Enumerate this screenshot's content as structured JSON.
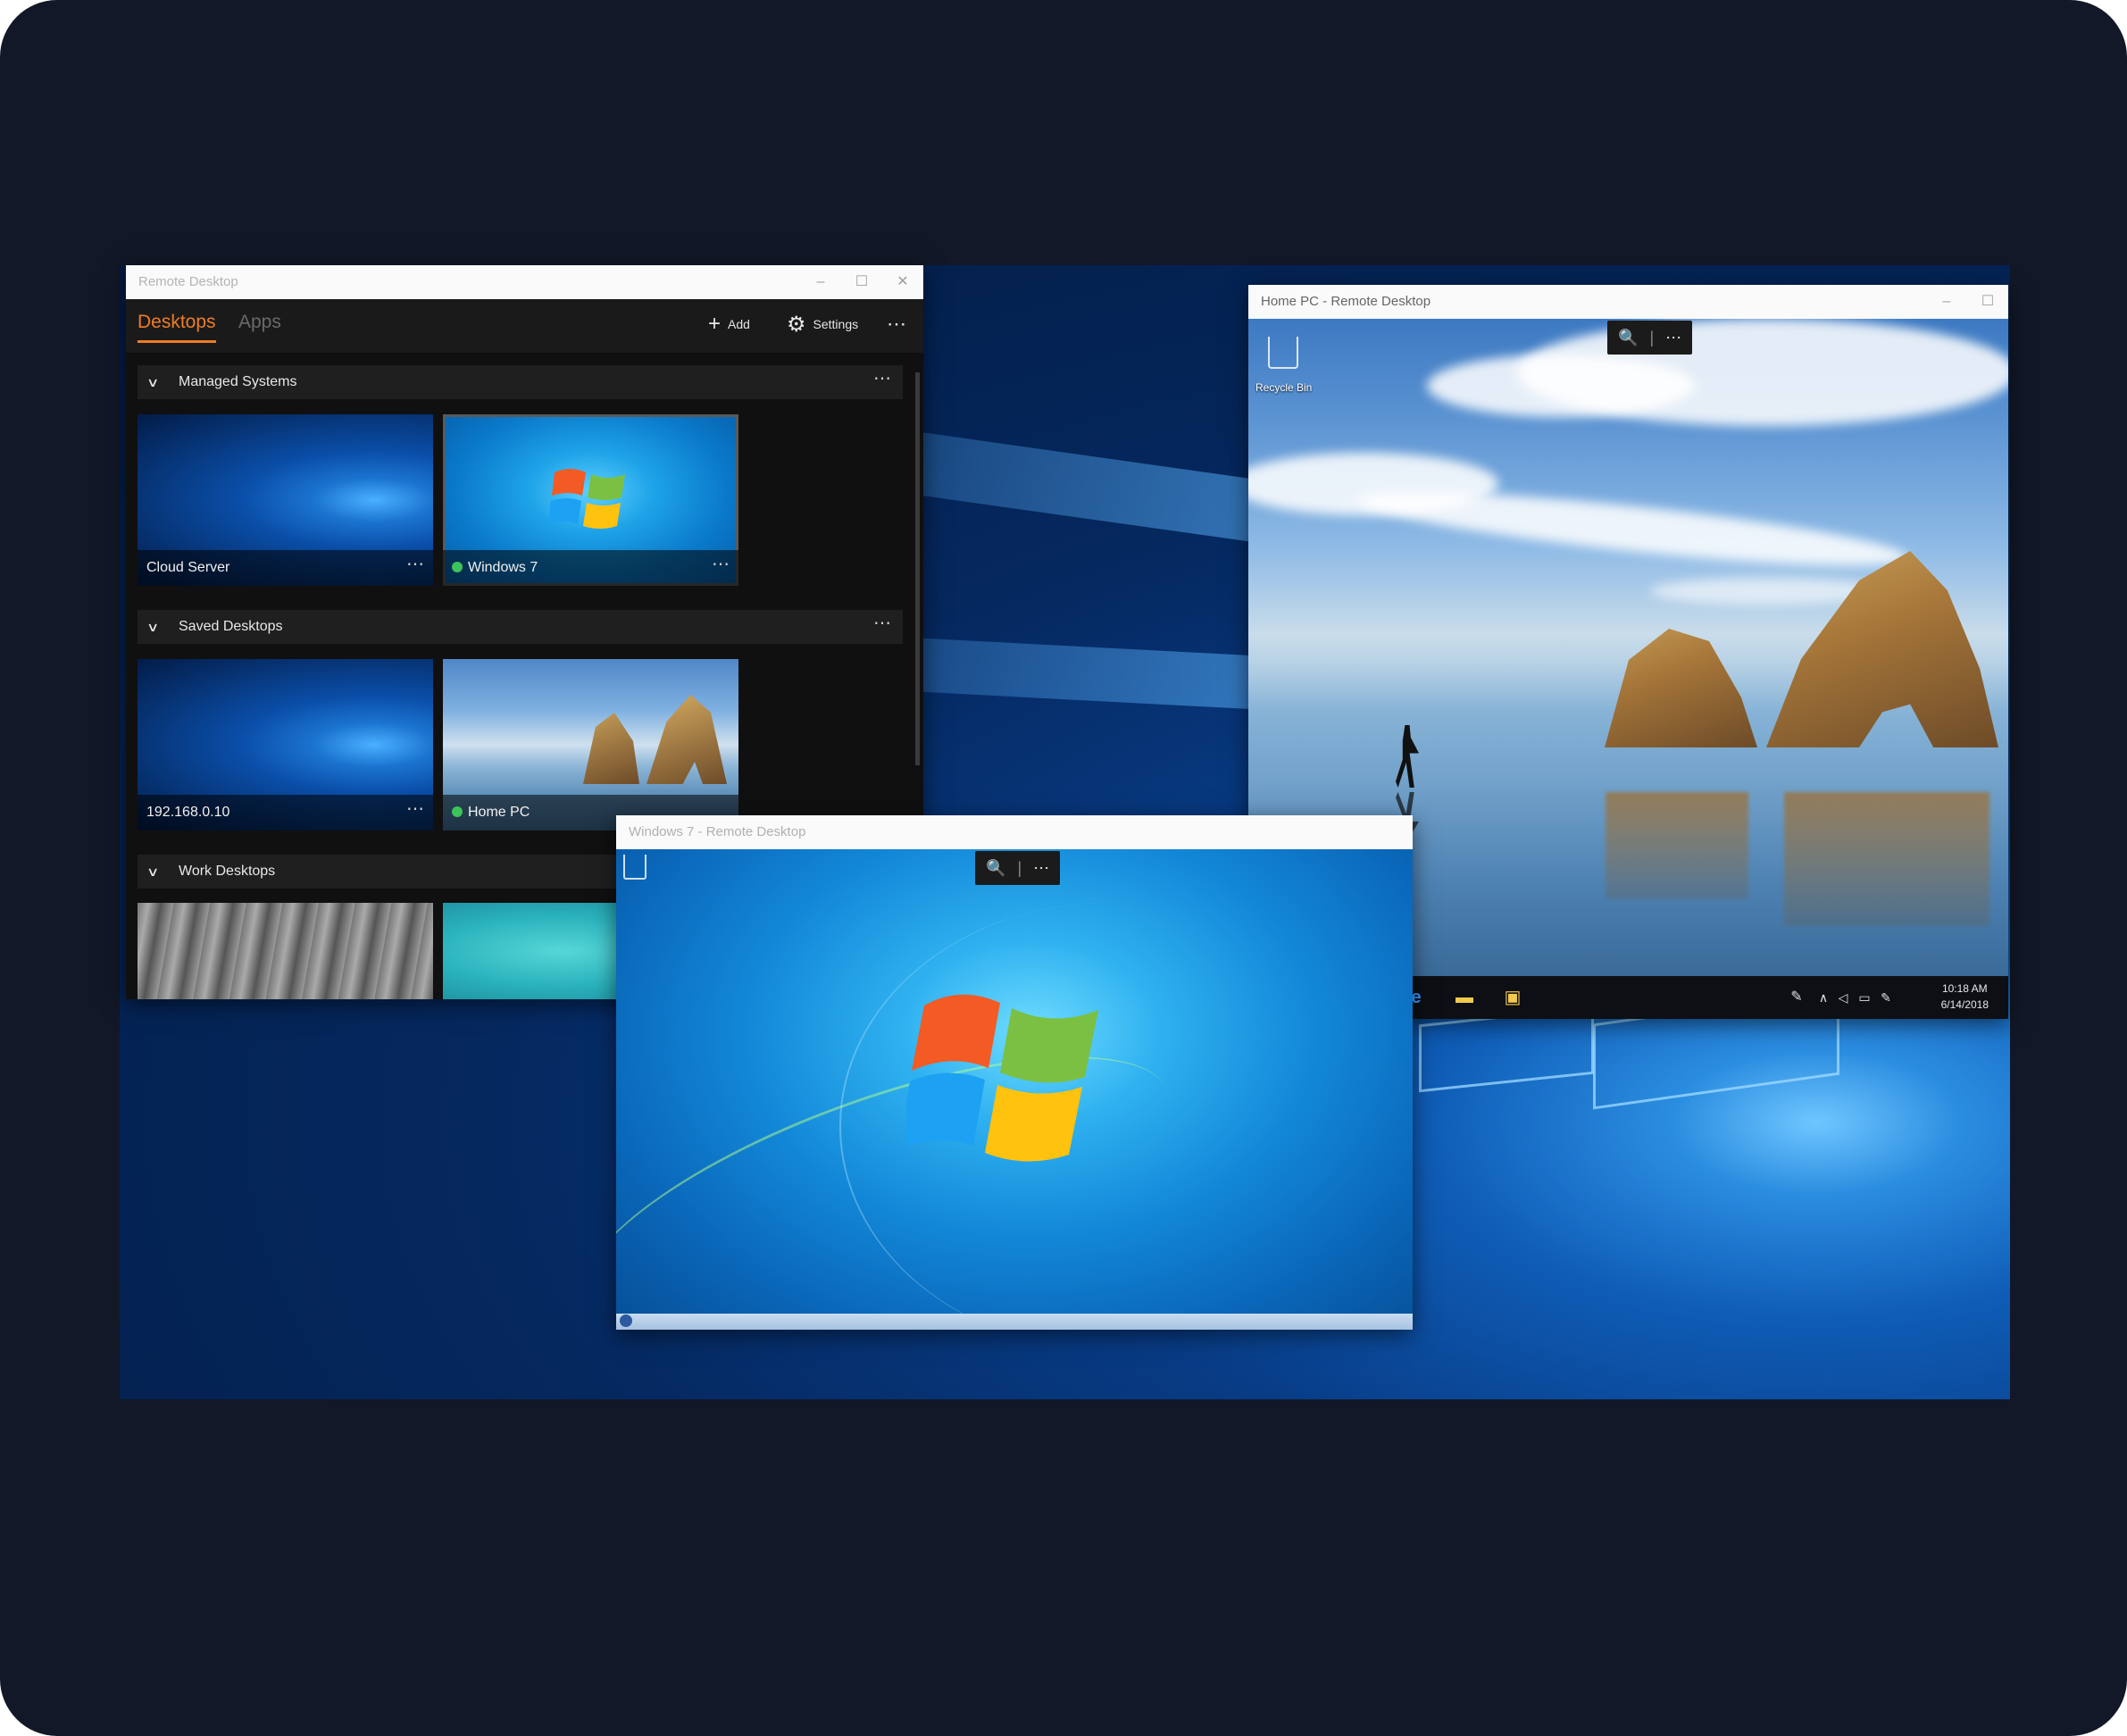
{
  "remote_desktop_app": {
    "window_title": "Remote Desktop",
    "tabs": [
      {
        "label": "Desktops",
        "active": true
      },
      {
        "label": "Apps",
        "active": false
      }
    ],
    "add_label": "Add",
    "settings_label": "Settings",
    "more_icon": "ellipsis-icon",
    "groups": [
      {
        "name": "Managed Systems",
        "tiles": [
          {
            "label": "Cloud Server",
            "online": false,
            "thumbnail": "windows-10-wallpaper"
          },
          {
            "label": "Windows 7",
            "online": true,
            "thumbnail": "windows-7-wallpaper"
          }
        ]
      },
      {
        "name": "Saved Desktops",
        "tiles": [
          {
            "label": "192.168.0.10",
            "online": false,
            "thumbnail": "windows-10-wallpaper"
          },
          {
            "label": "Home PC",
            "online": true,
            "thumbnail": "beach-wallpaper"
          }
        ]
      },
      {
        "name": "Work Desktops",
        "tiles": [
          {
            "label": "",
            "thumbnail": "rock-wallpaper"
          },
          {
            "label": "",
            "thumbnail": "teal-wallpaper"
          }
        ]
      }
    ],
    "accent_color": "#f07c24",
    "online_color": "#3cc35a"
  },
  "home_pc_window": {
    "window_title": "Home PC - Remote Desktop",
    "desktop_icon_label": "Recycle Bin",
    "taskbar": {
      "time": "10:18 AM",
      "date": "6/14/2018"
    }
  },
  "win7_window": {
    "window_title": "Windows 7 - Remote Desktop"
  }
}
